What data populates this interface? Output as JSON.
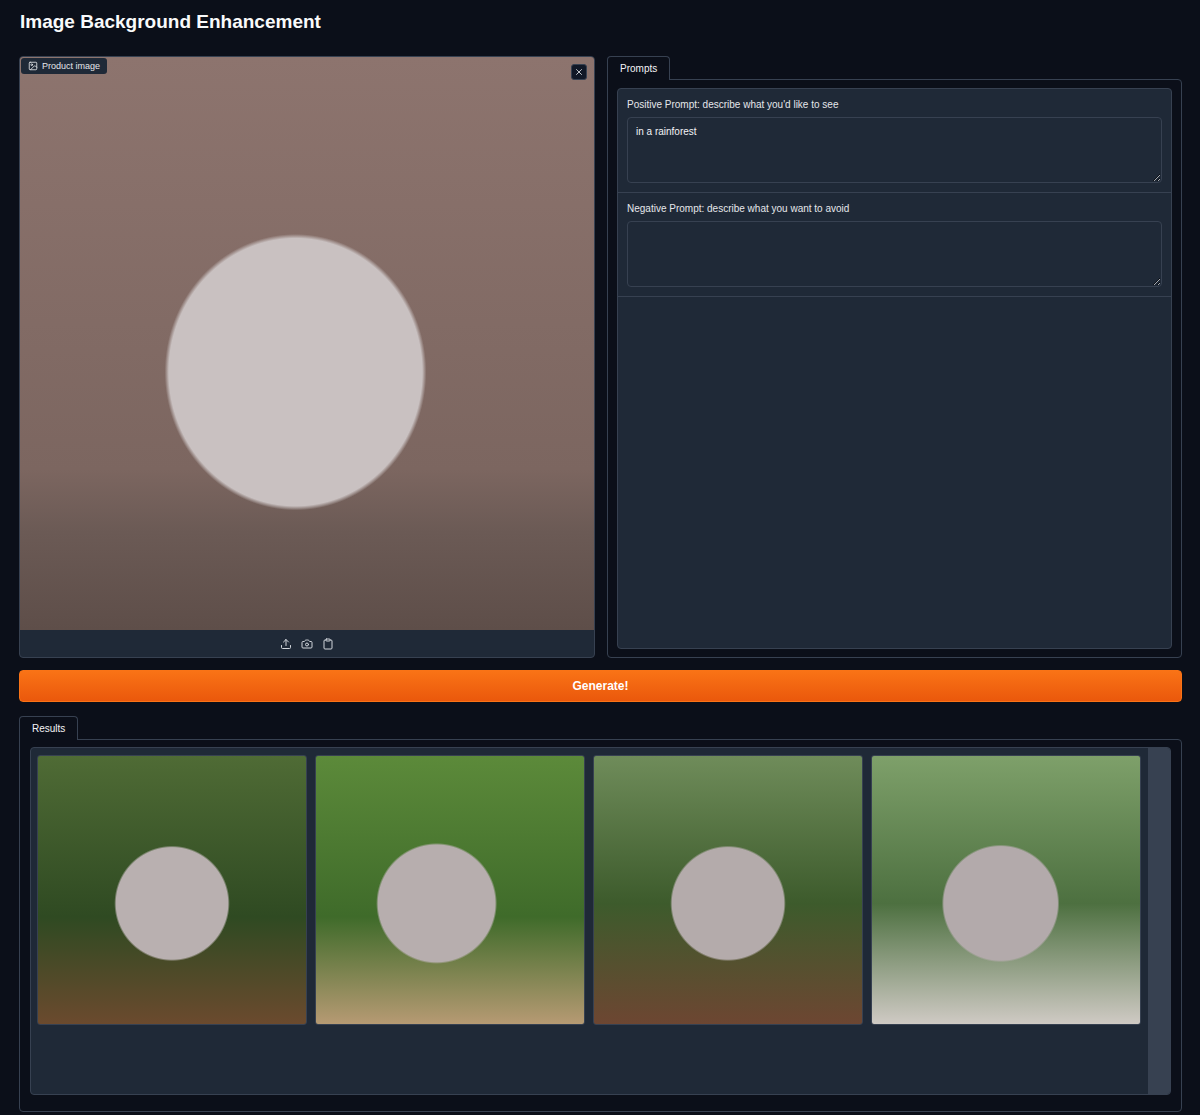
{
  "page": {
    "title": "Image Background Enhancement"
  },
  "image_input": {
    "label": "Product image"
  },
  "prompt_tabs": [
    {
      "label": "Prompts",
      "selected": true
    }
  ],
  "prompts": [
    {
      "label": "Positive Prompt: describe what you'd like to see",
      "value": "in a rainforest"
    },
    {
      "label": "Negative Prompt: describe what you want to avoid",
      "value": ""
    }
  ],
  "generate_button": {
    "label": "Generate!"
  },
  "result_tabs": [
    {
      "label": "Results",
      "selected": true
    }
  ]
}
